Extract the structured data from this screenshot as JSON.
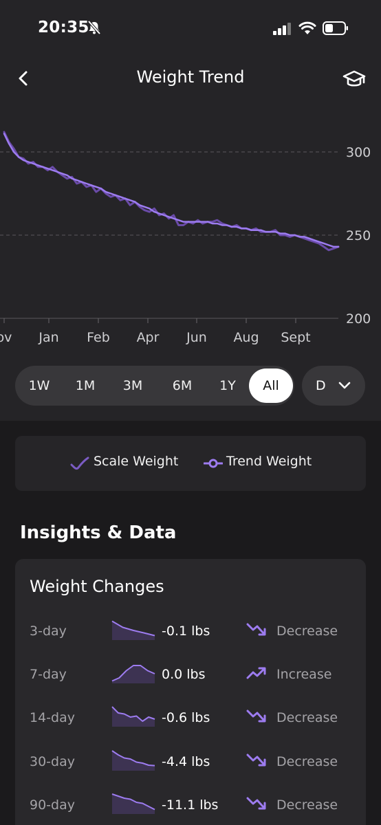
{
  "status_bar": {
    "time": "20:35"
  },
  "header": {
    "title": "Weight Trend",
    "back_icon": "chevron-left-icon",
    "info_icon": "graduation-cap-icon"
  },
  "chart_data": {
    "type": "line",
    "series": [
      {
        "name": "Scale Weight",
        "color": "#6a4ba8",
        "y": [
          312,
          306,
          302,
          297,
          296,
          293,
          294,
          291,
          291,
          289,
          291,
          288,
          286,
          284,
          285,
          281,
          282,
          279,
          280,
          276,
          278,
          275,
          273,
          274,
          271,
          272,
          268,
          270,
          267,
          265,
          264,
          266,
          262,
          263,
          260,
          262,
          256,
          256,
          258,
          257,
          259,
          257,
          258,
          258,
          259,
          257,
          256,
          255,
          256,
          254,
          254,
          253,
          254,
          252,
          252,
          252,
          253,
          250,
          250,
          249,
          250,
          249,
          248,
          247,
          246,
          245,
          243,
          241,
          242,
          243
        ]
      },
      {
        "name": "Trend Weight",
        "color": "#9d7cf0",
        "y": [
          311,
          305,
          300,
          297,
          295,
          294,
          293,
          292,
          291,
          290,
          289,
          288,
          287,
          286,
          284,
          283,
          282,
          281,
          280,
          279,
          278,
          276,
          275,
          274,
          273,
          272,
          271,
          270,
          268,
          267,
          266,
          264,
          263,
          262,
          261,
          260,
          259,
          258,
          258,
          258,
          258,
          258,
          258,
          257,
          257,
          256,
          256,
          255,
          255,
          254,
          254,
          253,
          253,
          253,
          252,
          252,
          252,
          251,
          251,
          250,
          250,
          249,
          249,
          248,
          247,
          246,
          245,
          244,
          243,
          243
        ]
      }
    ],
    "x_tick_labels": [
      "ov",
      "Jan",
      "Feb",
      "Apr",
      "Jun",
      "Aug",
      "Sept"
    ],
    "y_ticks": [
      300,
      250,
      200
    ],
    "ylim": [
      200,
      330
    ],
    "gridlines": "dashed"
  },
  "range_selector": {
    "options": [
      "1W",
      "1M",
      "3M",
      "6M",
      "1Y",
      "All"
    ],
    "selected": "All",
    "aggregation": "D"
  },
  "legend": {
    "scale_label": "Scale Weight",
    "trend_label": "Trend Weight"
  },
  "insights": {
    "section_title": "Insights & Data",
    "card_title": "Weight Changes",
    "rows": [
      {
        "period": "3-day",
        "value": "-0.1 lbs",
        "direction": "Decrease",
        "spark": [
          0.15,
          0.45,
          0.6,
          0.72,
          0.85
        ]
      },
      {
        "period": "7-day",
        "value": "0.0 lbs",
        "direction": "Increase",
        "spark": [
          0.95,
          0.8,
          0.45,
          0.2,
          0.2,
          0.45,
          0.6
        ]
      },
      {
        "period": "14-day",
        "value": "-0.6 lbs",
        "direction": "Decrease",
        "spark": [
          0.1,
          0.4,
          0.45,
          0.6,
          0.55,
          0.8,
          0.6,
          0.7
        ]
      },
      {
        "period": "30-day",
        "value": "-4.4 lbs",
        "direction": "Decrease",
        "spark": [
          0.1,
          0.3,
          0.45,
          0.5,
          0.65,
          0.7,
          0.8,
          0.82
        ]
      },
      {
        "period": "90-day",
        "value": "-11.1 lbs",
        "direction": "Decrease",
        "spark": [
          0.1,
          0.2,
          0.3,
          0.35,
          0.5,
          0.55,
          0.7,
          0.85
        ]
      }
    ]
  },
  "colors": {
    "accent": "#9d7cf0",
    "scale": "#6a4ba8",
    "spark_fill": "#3d3352"
  }
}
